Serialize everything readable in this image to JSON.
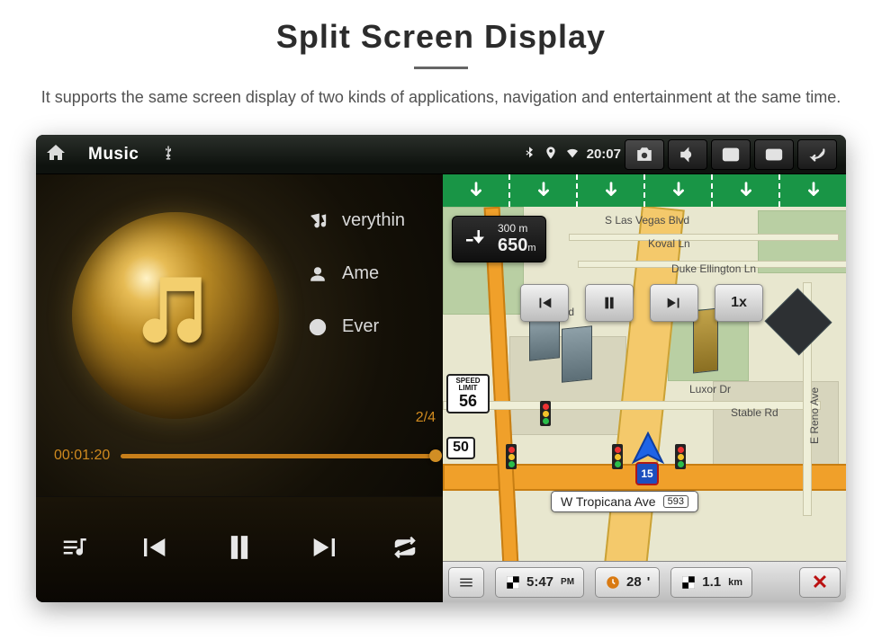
{
  "page": {
    "title": "Split Screen Display",
    "subtitle": "It supports the same screen display of two kinds of applications, navigation and entertainment at the same time."
  },
  "statusbar": {
    "app_title": "Music",
    "time": "20:07"
  },
  "music": {
    "track_title": "verythin",
    "artist": "Ame",
    "album": "Ever",
    "counter": "2/4",
    "elapsed": "00:01:20"
  },
  "map": {
    "turn_distance_main": "650",
    "turn_distance_main_unit": "m",
    "turn_distance_next": "300 m",
    "speed_rate": "1x",
    "streets": {
      "s_las_vegas": "S Las Vegas Blvd",
      "koval": "Koval Ln",
      "duke": "Duke Ellington Ln",
      "vegas_blvd_partial": "Vegas Blvd",
      "luxor": "Luxor Dr",
      "stable": "Stable Rd",
      "reno": "E Reno Ave",
      "tropicana": "W Tropicana Ave"
    },
    "route_badge": "593",
    "speed_limit_label": "SPEED LIMIT",
    "speed_limit_value": "56",
    "shield_route": "50",
    "interstate": "15",
    "bottom": {
      "eta": "5:47",
      "eta_suffix": "PM",
      "travel_time": "28",
      "travel_time_unit": "'",
      "distance": "1.1",
      "distance_unit": "km"
    }
  }
}
